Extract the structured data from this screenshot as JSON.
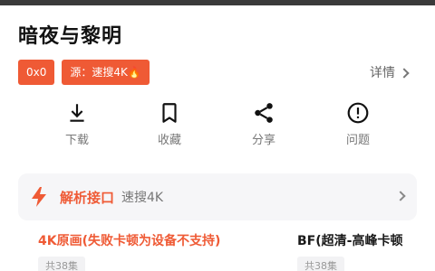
{
  "title": "暗夜与黎明",
  "tags": [
    "0x0",
    "源：速搜4K🔥"
  ],
  "details_label": "详情",
  "actions": [
    {
      "label": "下载",
      "icon": "download-icon"
    },
    {
      "label": "收藏",
      "icon": "bookmark-icon"
    },
    {
      "label": "分享",
      "icon": "share-icon"
    },
    {
      "label": "问题",
      "icon": "alert-circle-icon"
    }
  ],
  "parse": {
    "title": "解析接口",
    "value": "速搜4K",
    "icon": "lightning-icon"
  },
  "sources": [
    {
      "name": "4K原画(失败卡顿为设备不支持)",
      "count": "共38集"
    },
    {
      "name": "BF(超清-高峰卡顿",
      "count": "共38集"
    }
  ],
  "colors": {
    "accent": "#ef5a35",
    "muted_text": "#777777",
    "panel_bg": "#f6f6f8"
  }
}
